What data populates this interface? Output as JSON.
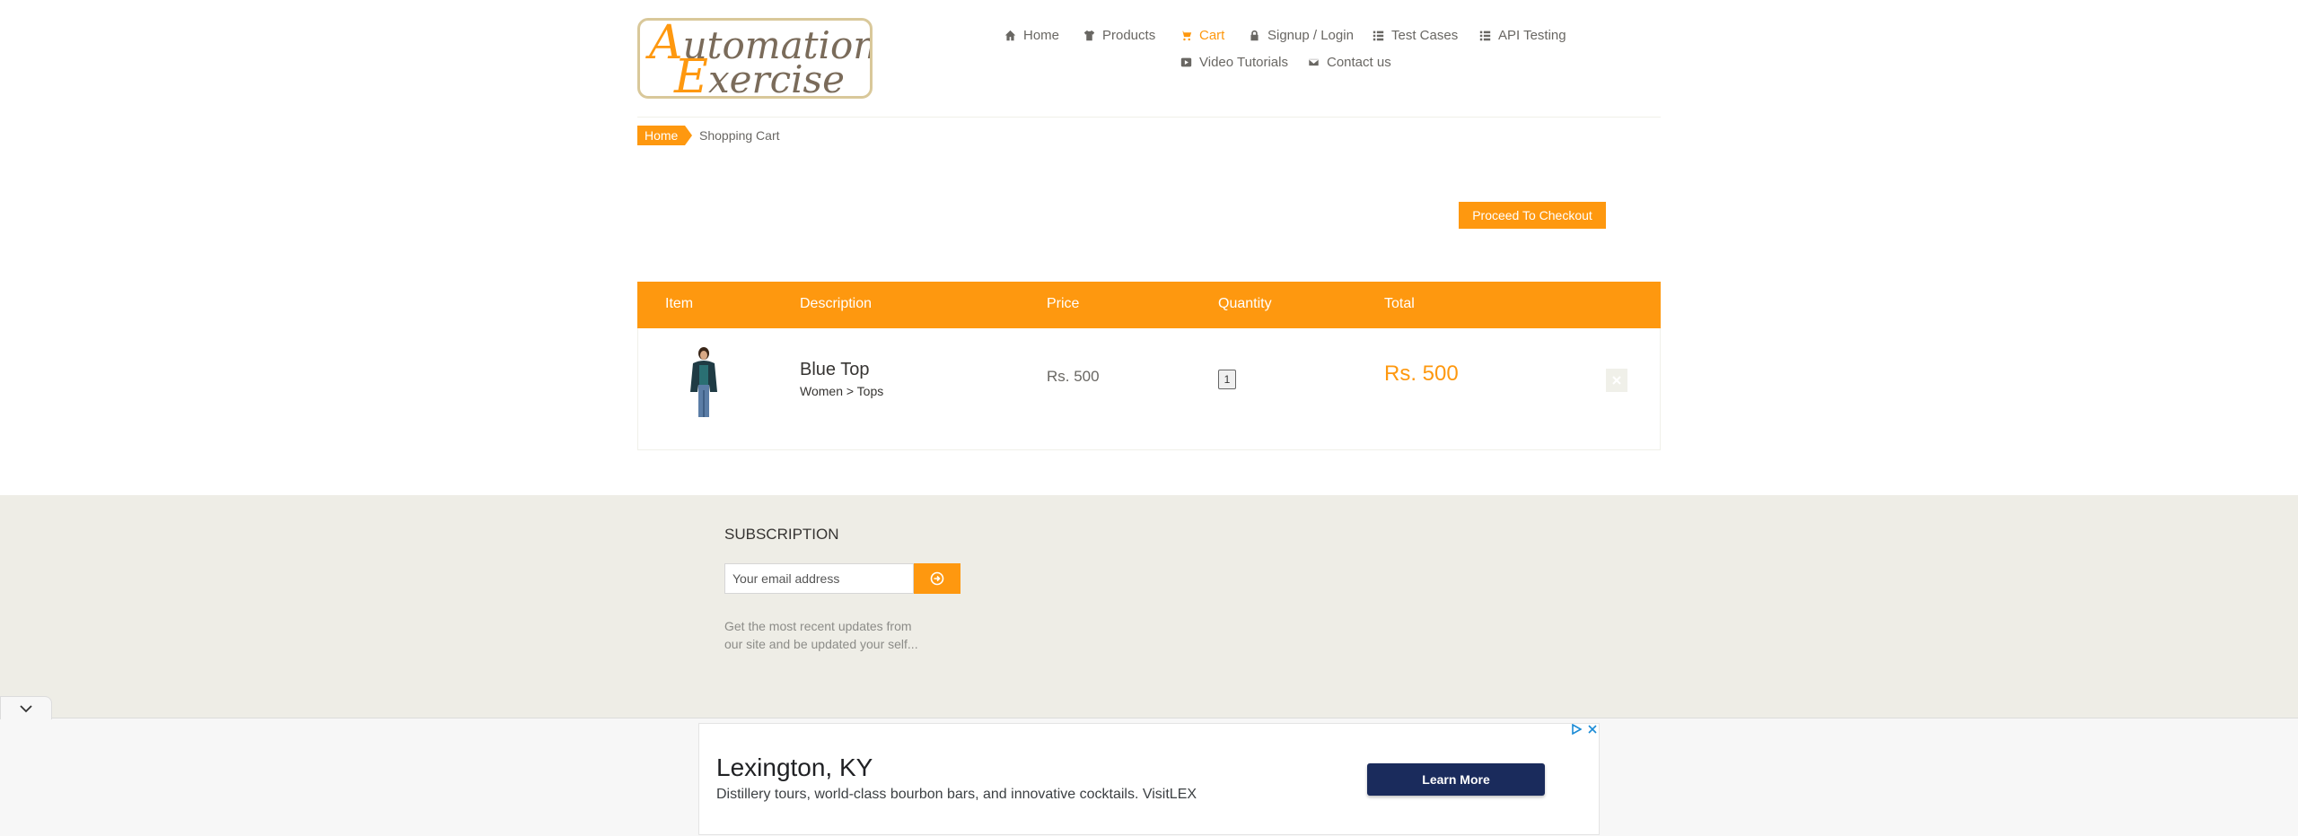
{
  "header": {
    "logo": {
      "line1_cap": "A",
      "line1_rest": "utomation",
      "line2_cap": "E",
      "line2_rest": "xercise"
    },
    "nav": {
      "home": "Home",
      "products": "Products",
      "cart": "Cart",
      "signup_login": "Signup / Login",
      "test_cases": "Test Cases",
      "api_testing": "API Testing",
      "video_tutorials": "Video Tutorials",
      "contact_us": "Contact us"
    },
    "active_nav": "cart"
  },
  "breadcrumb": {
    "home": "Home",
    "current": "Shopping Cart"
  },
  "checkout_button": "Proceed To Checkout",
  "cart": {
    "columns": {
      "item": "Item",
      "description": "Description",
      "price": "Price",
      "quantity": "Quantity",
      "total": "Total"
    },
    "rows": [
      {
        "name": "Blue Top",
        "category": "Women > Tops",
        "price": "Rs. 500",
        "quantity": "1",
        "total": "Rs. 500"
      }
    ]
  },
  "footer": {
    "subscription_title": "SUBSCRIPTION",
    "email_placeholder": "Your email address",
    "subscription_text": "Get the most recent updates from our site and be updated your self..."
  },
  "ad": {
    "title": "Lexington, KY",
    "description": "Distillery tours, world-class bourbon bars, and innovative cocktails. VisitLEX",
    "cta": "Learn More"
  },
  "colors": {
    "accent": "#fe980f",
    "ad_button": "#1a2b5c",
    "footer_bg": "#eeede6"
  },
  "icons": [
    "home-icon",
    "shirt-icon",
    "cart-icon",
    "lock-icon",
    "list-icon",
    "youtube-icon",
    "envelope-icon",
    "delete-icon",
    "arrow-circle-right-icon",
    "chevron-down-icon",
    "adchoices-icon",
    "close-icon"
  ]
}
